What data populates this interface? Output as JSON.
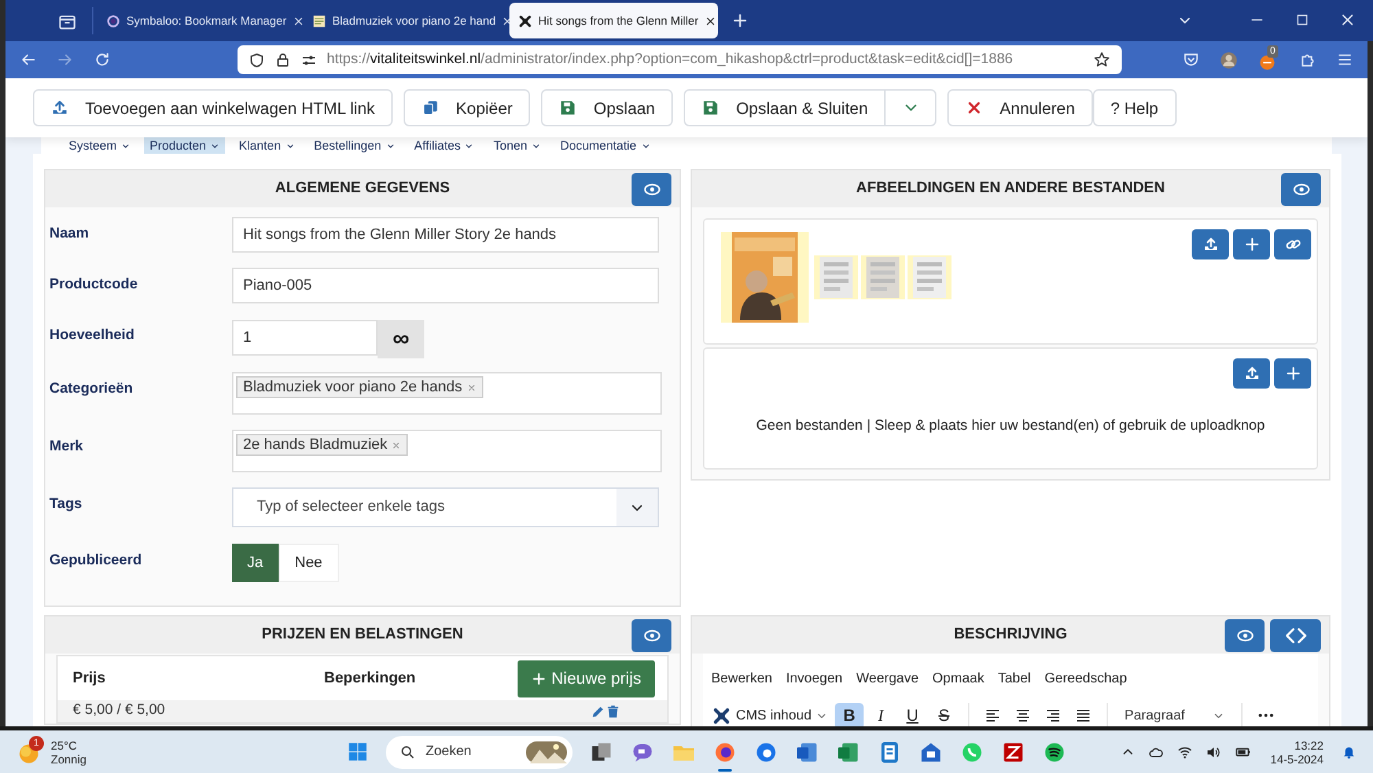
{
  "browser": {
    "tabs": [
      {
        "title": "Symbaloo: Bookmark Manager",
        "kind": "ring",
        "selected": false
      },
      {
        "title": "Bladmuziek voor piano 2e hand",
        "kind": "page",
        "selected": false
      },
      {
        "title": "Hit songs from the Glenn Miller",
        "kind": "knot",
        "selected": true
      }
    ],
    "url_prefix": "https://",
    "url_domain": "vitaliteitswinkel.nl",
    "url_rest": "/administrator/index.php?option=com_hikashop&ctrl=product&task=edit&cid[]=1886",
    "extension_badge": "0"
  },
  "toolbar": [
    {
      "label": "Toevoegen aan winkelwagen HTML link",
      "kind": "upload"
    },
    {
      "label": "Kopiëer",
      "kind": "copy"
    },
    {
      "label": "Opslaan",
      "kind": "save"
    },
    {
      "label": "Opslaan & Sluiten",
      "kind": "split"
    },
    {
      "label": "Annuleren",
      "kind": "cancel"
    },
    {
      "label": "? Help",
      "kind": "plain"
    }
  ],
  "menu": [
    {
      "label": "Systeem",
      "selected": false
    },
    {
      "label": "Producten",
      "selected": true
    },
    {
      "label": "Klanten",
      "selected": false
    },
    {
      "label": "Bestellingen",
      "selected": false
    },
    {
      "label": "Affiliates",
      "selected": false
    },
    {
      "label": "Tonen",
      "selected": false
    },
    {
      "label": "Documentatie",
      "selected": false
    }
  ],
  "general": {
    "title": "ALGEMENE GEGEVENS",
    "fields": [
      {
        "label": "Naam",
        "kind": "text",
        "value": "Hit songs from the Glenn Miller Story 2e hands"
      },
      {
        "label": "Productcode",
        "kind": "text",
        "value": "Piano-005"
      },
      {
        "label": "Hoeveelheid",
        "kind": "quantity",
        "value": "1",
        "addon": "∞"
      },
      {
        "label": "Categorieën",
        "kind": "chips",
        "chips": [
          "Bladmuziek voor piano 2e hands"
        ]
      },
      {
        "label": "Merk",
        "kind": "chips",
        "chips": [
          "2e hands Bladmuziek"
        ]
      },
      {
        "label": "Tags",
        "kind": "select",
        "placeholder": "Typ of selecteer enkele tags"
      },
      {
        "label": "Gepubliceerd",
        "kind": "toggle",
        "options": [
          {
            "label": "Ja",
            "selected": true
          },
          {
            "label": "Nee",
            "selected": false
          }
        ]
      }
    ]
  },
  "images": {
    "title": "AFBEELDINGEN EN ANDERE BESTANDEN",
    "files_note": "Geen bestanden | Sleep & plaats hier uw bestand(en) of gebruik de uploadknop"
  },
  "prices": {
    "title": "PRIJZEN EN BELASTINGEN",
    "columns": [
      "Prijs",
      "Beperkingen"
    ],
    "new_button": "Nieuwe prijs",
    "rows": [
      {
        "price": "€ 5,00 / € 5,00"
      }
    ]
  },
  "description": {
    "title": "BESCHRIJVING",
    "menus": [
      "Bewerken",
      "Invoegen",
      "Weergave",
      "Opmaak",
      "Tabel",
      "Gereedschap"
    ],
    "content_menu": "CMS inhoud",
    "format_buttons": [
      {
        "label": "B",
        "kind": "bold",
        "selected": true
      },
      {
        "label": "I",
        "kind": "italic",
        "selected": false
      },
      {
        "label": "U",
        "kind": "underline",
        "selected": false
      },
      {
        "label": "S",
        "kind": "strike",
        "selected": false
      }
    ],
    "block_format": "Paragraaf"
  },
  "taskbar": {
    "weather_badge": "1",
    "temperature": "25°C",
    "condition": "Zonnig",
    "search_placeholder": "Zoeken",
    "time": "13:22",
    "date": "14-5-2024"
  }
}
